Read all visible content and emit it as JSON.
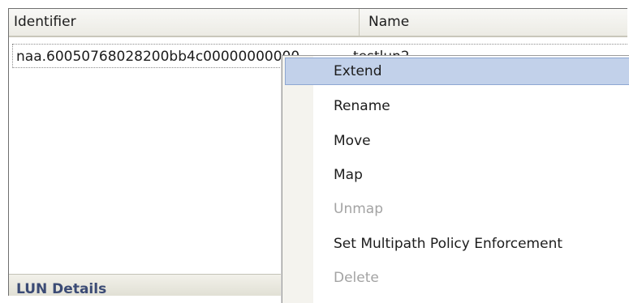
{
  "table": {
    "headers": {
      "identifier": "Identifier",
      "name": "Name"
    },
    "rows": [
      {
        "identifier": "naa.60050768028200bb4c00000000000",
        "name": "testlun2"
      }
    ]
  },
  "lun_details": {
    "label": "LUN Details"
  },
  "context_menu": {
    "items": [
      {
        "label": "Extend",
        "state": "highlighted"
      },
      {
        "label": "Rename",
        "state": "enabled"
      },
      {
        "label": "Move",
        "state": "enabled"
      },
      {
        "label": "Map",
        "state": "enabled"
      },
      {
        "label": "Unmap",
        "state": "disabled"
      },
      {
        "label": "Set Multipath Policy Enforcement",
        "state": "enabled"
      },
      {
        "label": "Delete",
        "state": "disabled"
      }
    ]
  },
  "colors": {
    "highlight": "#c2d1ea",
    "disabled_text": "#a3a3a3",
    "section_label": "#3b4b75"
  }
}
